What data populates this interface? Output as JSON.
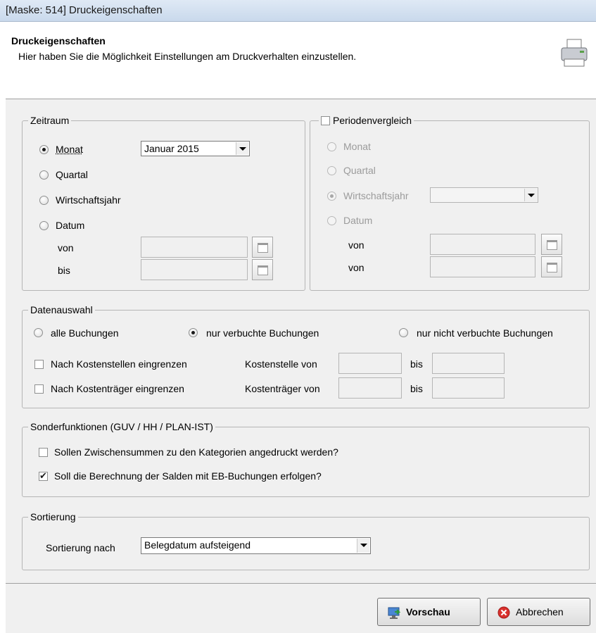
{
  "window": {
    "title": "[Maske: 514] Druckeigenschaften"
  },
  "header": {
    "title": "Druckeigenschaften",
    "subtitle": "Hier haben Sie die Möglichkeit Einstellungen am Druckverhalten einzustellen.",
    "icon": "printer-icon"
  },
  "zeitraum": {
    "legend": "Zeitraum",
    "options": [
      "Monat",
      "Quartal",
      "Wirtschaftsjahr",
      "Datum"
    ],
    "selected": "Monat",
    "month_value": "Januar 2015",
    "von_label": "von",
    "bis_label": "bis"
  },
  "periodenvergleich": {
    "legend": "Periodenvergleich",
    "checked": false,
    "options": [
      "Monat",
      "Quartal",
      "Wirtschaftsjahr",
      "Datum"
    ],
    "selected": "Wirtschaftsjahr",
    "von_label_1": "von",
    "von_label_2": "von"
  },
  "datenauswahl": {
    "legend": "Datenauswahl",
    "options": [
      "alle Buchungen",
      "nur verbuchte Buchungen",
      "nur nicht verbuchte Buchungen"
    ],
    "selected": "nur verbuchte Buchungen",
    "kostenstellen_check": "Nach Kostenstellen eingrenzen",
    "kostentraeger_check": "Nach Kostenträger eingrenzen",
    "kostenstelle_von": "Kostenstelle von",
    "kostentraeger_von": "Kostenträger von",
    "bis_label": "bis"
  },
  "sonderfunktionen": {
    "legend": "Sonderfunktionen (GUV / HH / PLAN-IST)",
    "zwischensummen": "Sollen Zwischensummen zu den Kategorien angedruckt werden?",
    "zwischensummen_checked": false,
    "salden_eb": "Soll die Berechnung der Salden mit EB-Buchungen erfolgen?",
    "salden_eb_checked": true
  },
  "sortierung": {
    "legend": "Sortierung",
    "label": "Sortierung nach",
    "value": "Belegdatum aufsteigend"
  },
  "buttons": {
    "preview": "Vorschau",
    "cancel": "Abbrechen"
  },
  "colors": {
    "accent": "#2f6fbd",
    "cancel_red": "#d9302c"
  }
}
